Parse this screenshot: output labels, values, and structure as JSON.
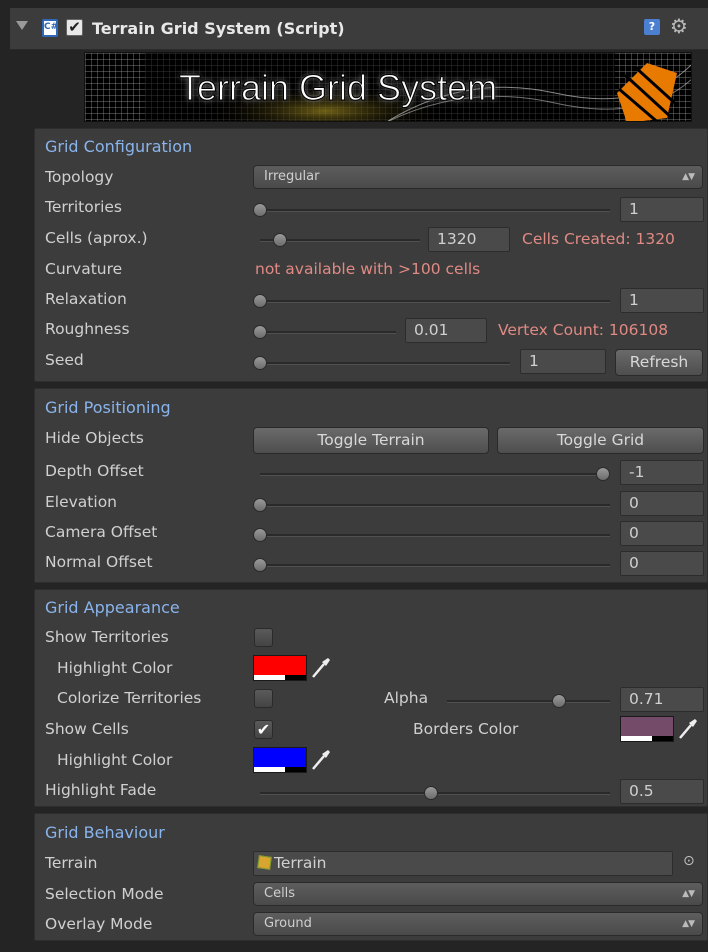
{
  "header": {
    "title": "Terrain Grid System (Script)",
    "enabled_mark": "✔",
    "help_glyph": "?",
    "gear_glyph": "⚙"
  },
  "banner": {
    "text": "Terrain Grid System"
  },
  "config": {
    "title": "Grid Configuration",
    "topology": {
      "label": "Topology",
      "value": "Irregular"
    },
    "territories": {
      "label": "Territories",
      "value": "1"
    },
    "cells": {
      "label": "Cells (aprox.)",
      "value": "1320",
      "note": "Cells Created: 1320"
    },
    "curvature": {
      "label": "Curvature",
      "note": "not available with >100 cells"
    },
    "relaxation": {
      "label": "Relaxation",
      "value": "1"
    },
    "roughness": {
      "label": "Roughness",
      "value": "0.01",
      "note": "Vertex Count: 106108"
    },
    "seed": {
      "label": "Seed",
      "value": "1",
      "button": "Refresh"
    }
  },
  "positioning": {
    "title": "Grid Positioning",
    "hide_objects": {
      "label": "Hide Objects",
      "btn_terrain": "Toggle Terrain",
      "btn_grid": "Toggle Grid"
    },
    "depth_offset": {
      "label": "Depth Offset",
      "value": "-1"
    },
    "elevation": {
      "label": "Elevation",
      "value": "0"
    },
    "camera_offset": {
      "label": "Camera Offset",
      "value": "0"
    },
    "normal_offset": {
      "label": "Normal Offset",
      "value": "0"
    }
  },
  "appearance": {
    "title": "Grid Appearance",
    "show_territories": {
      "label": "Show Territories",
      "checked": false
    },
    "territory_highlight": {
      "label": "Highlight Color",
      "color": "#ff0000"
    },
    "colorize": {
      "label": "Colorize Territories",
      "checked": false
    },
    "alpha": {
      "label": "Alpha",
      "value": "0.71"
    },
    "show_cells": {
      "label": "Show Cells",
      "checked": true,
      "mark": "✔"
    },
    "borders_color": {
      "label": "Borders Color",
      "color": "#744b69"
    },
    "cell_highlight": {
      "label": "Highlight Color",
      "color": "#0000ff"
    },
    "highlight_fade": {
      "label": "Highlight Fade",
      "value": "0.5"
    }
  },
  "behaviour": {
    "title": "Grid Behaviour",
    "terrain": {
      "label": "Terrain",
      "value": "Terrain",
      "picker_glyph": "⊙"
    },
    "selection_mode": {
      "label": "Selection Mode",
      "value": "Cells"
    },
    "overlay_mode": {
      "label": "Overlay Mode",
      "value": "Ground"
    }
  },
  "dropdown_arrow": "▲▼"
}
